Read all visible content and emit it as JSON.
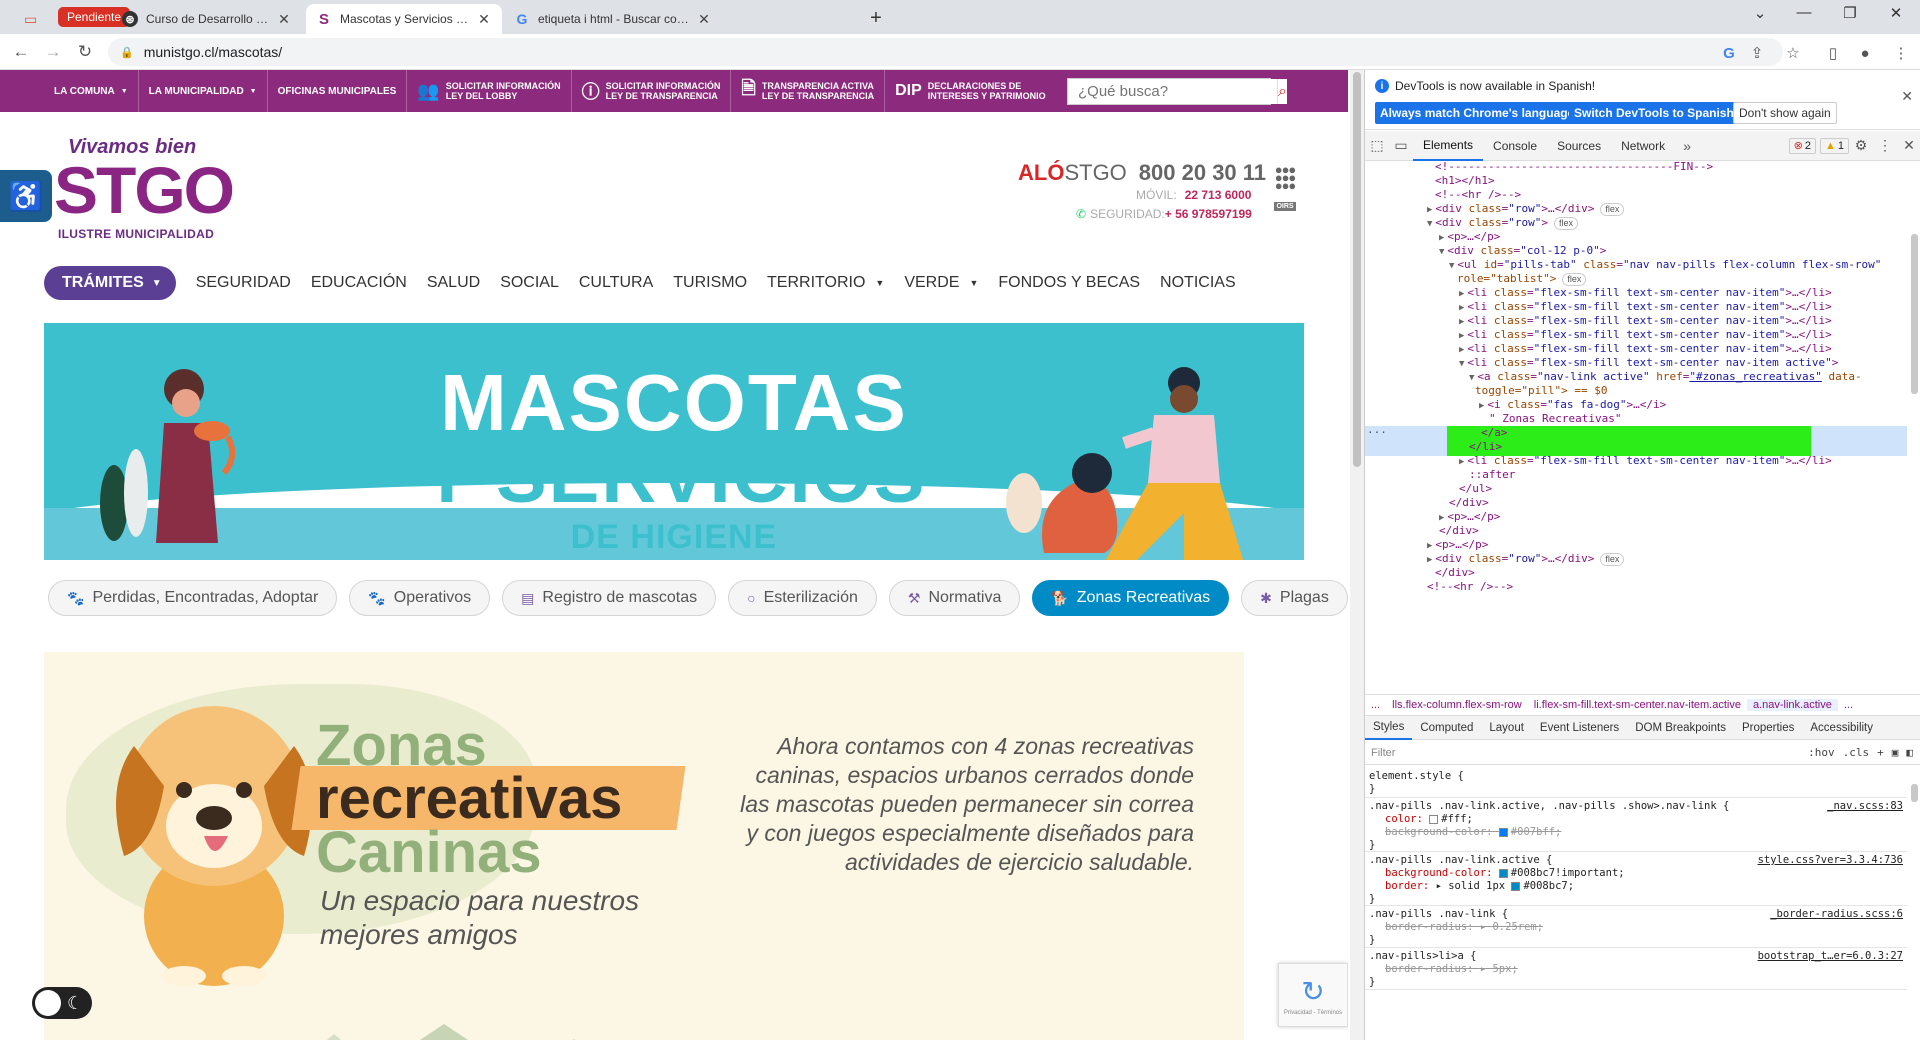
{
  "browser": {
    "pending_label": "Pendiente",
    "tabs": [
      {
        "title": "Curso de Desarrollo Web | Platafo"
      },
      {
        "title": "Mascotas y Servicios de Higiene"
      },
      {
        "title": "etiqueta i html - Buscar con Goo"
      }
    ],
    "url": "munistgo.cl/mascotas/"
  },
  "site": {
    "topbar": {
      "items": [
        "LA COMUNA",
        "LA MUNICIPALIDAD",
        "OFICINAS MUNICIPALES"
      ],
      "lobby": [
        "SOLICITAR INFORMACIÓN",
        "LEY DEL LOBBY"
      ],
      "transp": [
        "SOLICITAR INFORMACIÓN",
        "LEY DE TRANSPARENCIA"
      ],
      "activa": [
        "TRANSPARENCIA ACTIVA",
        "LEY DE TRANSPARENCIA"
      ],
      "dip": "DIP",
      "dip_lines": [
        "DECLARACIONES DE",
        "INTERESES Y PATRIMONIO"
      ],
      "search_placeholder": "¿Qué busca?"
    },
    "logo": {
      "tagline": "Vivamos bien",
      "name": "STGO",
      "subtitle": "ILUSTRE MUNICIPALIDAD"
    },
    "contact": {
      "alo_red": "ALÓ",
      "alo_rest": "STGO",
      "phone": "800 20 30 11",
      "movil_label": "MÓVIL:",
      "movil": "22 713 6000",
      "seguridad_label": "SEGURIDAD:",
      "seguridad": "+ 56 978597199",
      "oirs": "OIRS"
    },
    "nav": {
      "tramites": "TRÁMITES",
      "items": [
        "SEGURIDAD",
        "EDUCACIÓN",
        "SALUD",
        "SOCIAL",
        "CULTURA",
        "TURISMO",
        "TERRITORIO",
        "VERDE",
        "FONDOS Y BECAS",
        "NOTICIAS"
      ]
    },
    "banner": {
      "line1": "MASCOTAS",
      "line2": "Y SERVICIOS",
      "line3": "DE HIGIENE"
    },
    "pills": [
      "Perdidas, Encontradas, Adoptar",
      "Operativos",
      "Registro de mascotas",
      "Esterilización",
      "Normativa",
      "Zonas Recreativas",
      "Plagas"
    ],
    "card": {
      "title1": "Zonas",
      "title2": "recreativas",
      "title3": "Caninas",
      "subtitle": "Un espacio para nuestros mejores amigos",
      "description": "Ahora contamos con 4 zonas recreativas caninas, espacios urbanos cerrados donde las mascotas pueden permanecer sin correa y con juegos especialmente diseñados para actividades de ejercicio saludable."
    },
    "recaptcha": "Privacidad - Términos"
  },
  "devtools": {
    "banner_msg": "DevTools is now available in Spanish!",
    "btn_match": "Always match Chrome's language",
    "btn_switch": "Switch DevTools to Spanish",
    "btn_dont": "Don't show again",
    "tabs": [
      "Elements",
      "Console",
      "Sources",
      "Network"
    ],
    "errors": "2",
    "warnings": "1",
    "crumbs": [
      "...",
      "lls.flex-column.flex-sm-row",
      "li.flex-sm-fill.text-sm-center.nav-item.active",
      "a.nav-link.active",
      "..."
    ],
    "subtabs": [
      "Styles",
      "Computed",
      "Layout",
      "Event Listeners",
      "DOM Breakpoints",
      "Properties",
      "Accessibility"
    ],
    "filter_placeholder": "Filter",
    "hov": ":hov",
    "cls": ".cls",
    "flex_badge": "flex",
    "dom": {
      "l0": "<!----------------------------------FIN-->",
      "l1": "<h1></h1>",
      "l2": "<!--<hr />-->",
      "row_tag": "div",
      "row_attr": "class",
      "row_val": "\"row\"",
      "row_end": ">…</div>",
      "row_open": ">",
      "p_collapsed": "<p>…</p>",
      "col_val": "\"col-12 p-0\"",
      "ul_id": "\"pills-tab\"",
      "ul_class": "\"nav nav-pills flex-column flex-sm-row\"",
      "ul_role": "role=\"tablist\">",
      "li_val": "\"flex-sm-fill text-sm-center nav-item\"",
      "li_active_val": "\"flex-sm-fill text-sm-center nav-item active\"",
      "a_class": "\"nav-link active\"",
      "a_href": "\"#zonas_recreativas\"",
      "a_toggle": "toggle=\"pill\"> == $0",
      "i_class": "\"fas fa-dog\"",
      "text_node": "\" Zonas Recreativas\"",
      "a_close": "</a>",
      "li_close": "</li>",
      "after": "::after",
      "ul_close": "</ul>",
      "div_close": "</div>"
    },
    "styles": {
      "element_style": "element.style {",
      "r1_sel": ".nav-pills .nav-link.active, .nav-pills .show>.nav-link {",
      "r1_src": "_nav.scss:83",
      "r1_p1": "color:",
      "r1_v1": "#fff;",
      "r1_p2": "background-color:",
      "r1_v2": "#007bff;",
      "r2_sel": ".nav-pills .nav-link.active {",
      "r2_src": "style.css?ver=3.3.4:736",
      "r2_p1": "background-color:",
      "r2_v1": "#008bc7!important;",
      "r2_p2": "border:",
      "r2_v2": "▸ solid 1px",
      "r2_v2b": "#008bc7;",
      "r3_sel": ".nav-pills .nav-link {",
      "r3_src": "_border-radius.scss:6",
      "r3_p1": "border-radius:",
      "r3_v1": "▸ 0.25rem;",
      "r4_sel": ".nav-pills>li>a {",
      "r4_src": "bootstrap_t…er=6.0.3:27",
      "r4_p1": "border-radius:",
      "r4_v1": "▸ 5px;",
      "close": "}"
    }
  }
}
